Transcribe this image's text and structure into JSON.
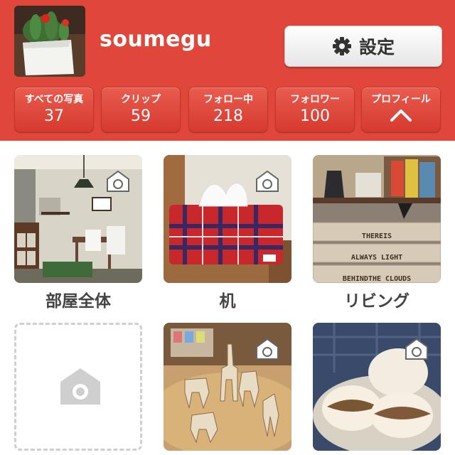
{
  "profile": {
    "username": "soumegu"
  },
  "settings": {
    "label": "設定",
    "icon": "gear-icon"
  },
  "stats": [
    {
      "label": "すべての写真",
      "value": "37"
    },
    {
      "label": "クリップ",
      "value": "59"
    },
    {
      "label": "フォロー中",
      "value": "218"
    },
    {
      "label": "フォロワー",
      "value": "100"
    },
    {
      "label": "プロフィール",
      "icon": "chevron-up-icon"
    }
  ],
  "rooms": [
    {
      "caption": "部屋全体"
    },
    {
      "caption": "机"
    },
    {
      "caption": "リビング"
    },
    {
      "caption": ""
    },
    {
      "caption": ""
    },
    {
      "caption": ""
    }
  ],
  "decor_sign": [
    "THEREIS",
    "ALWAYS LIGHT",
    "BEHINDTHE CLOUDS"
  ],
  "colors": {
    "header": "#e0473a",
    "stat_button": "#d63a2e",
    "caption": "#444444",
    "placeholder": "#cfcfcf"
  }
}
